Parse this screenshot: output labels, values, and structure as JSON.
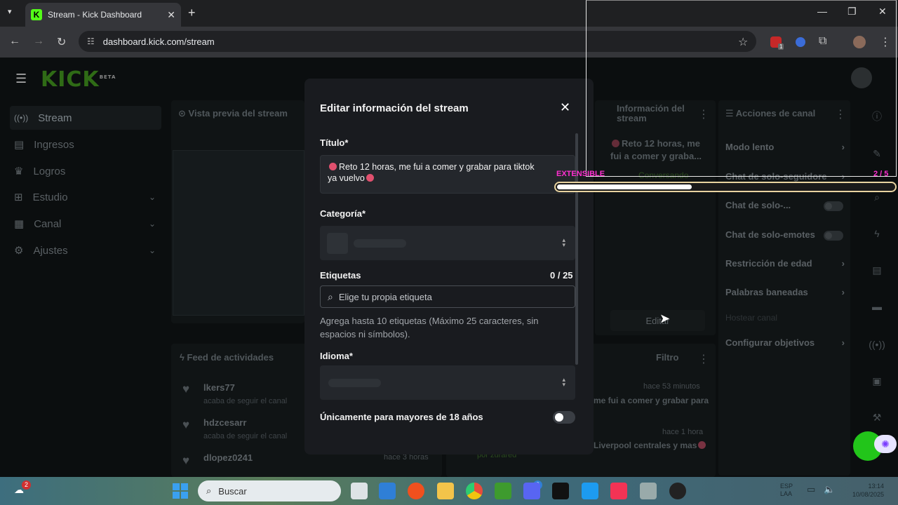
{
  "browser": {
    "tab_title": "Stream - Kick Dashboard",
    "favicon_letter": "K",
    "url": "dashboard.kick.com/stream",
    "ext_badge": "1"
  },
  "app": {
    "logo": "KICK",
    "logo_badge": "BETA"
  },
  "sidebar": {
    "items": [
      {
        "label": "Stream",
        "icon": "broadcast-icon",
        "active": true
      },
      {
        "label": "Ingresos",
        "icon": "wallet-icon"
      },
      {
        "label": "Logros",
        "icon": "trophy-icon"
      },
      {
        "label": "Estudio",
        "icon": "studio-icon",
        "expandable": true
      },
      {
        "label": "Canal",
        "icon": "channel-icon",
        "expandable": true
      },
      {
        "label": "Ajustes",
        "icon": "gear-icon",
        "expandable": true
      }
    ]
  },
  "preview": {
    "title": "Vista previa del stream"
  },
  "stream_info": {
    "title": "Información del stream",
    "snippet": "Reto 12 horas, me fui a comer y graba...",
    "edit_button": "Editar",
    "category_snippet": "Conversando"
  },
  "activity": {
    "title": "Feed de actividades",
    "filter": "Filtro",
    "items": [
      {
        "user": "lkers77",
        "action": "acaba de seguir el canal",
        "time": "hace 53 minutos"
      },
      {
        "user": "hdzcesarr",
        "action": "acaba de seguir el canal",
        "time": "hace 1 hora"
      },
      {
        "user": "dlopez0241",
        "action": "",
        "time": "hace 3 horas"
      }
    ],
    "message_1": "me fui a comer y grabar para",
    "message_2": "Liverpool centrales y mas",
    "by_user": "por zurared"
  },
  "channel_actions": {
    "title": "Acciones de canal",
    "items": [
      {
        "label": "Modo lento",
        "kind": "arrow"
      },
      {
        "label": "Chat de solo-seguidore",
        "kind": "arrow"
      },
      {
        "label": "Chat de solo-...",
        "kind": "toggle"
      },
      {
        "label": "Chat de solo-emotes",
        "kind": "toggle"
      },
      {
        "label": "Restricción de edad",
        "kind": "arrow"
      },
      {
        "label": "Palabras baneadas",
        "kind": "arrow"
      },
      {
        "label": "Hostear canal",
        "kind": "disabled"
      },
      {
        "label": "Configurar objetivos",
        "kind": "arrow"
      }
    ]
  },
  "modal": {
    "title": "Editar información del stream",
    "title_label": "Título*",
    "title_value_a": "Reto 12 horas, me fui a comer y grabar para tiktok",
    "title_value_b": "ya vuelvo",
    "category_label": "Categoría*",
    "tags_label": "Etiquetas",
    "tags_count": "0 / 25",
    "tags_placeholder": "Elige tu propia etiqueta",
    "tags_help": "Agrega hasta 10 etiquetas (Máximo 25 caracteres, sin espacios ni símbolos).",
    "language_label": "Idioma*",
    "adults_label": "Únicamente para mayores de 18 años",
    "adults_enabled": false
  },
  "extension_overlay": {
    "label": "EXTENSIBLE",
    "count": "2 / 5",
    "progress": 0.4
  },
  "taskbar": {
    "search_placeholder": "Buscar",
    "notif_badge": "2",
    "app_badge": "3",
    "lang_line1": "ESP",
    "lang_line2": "LAA",
    "time": "13:14",
    "date": "10/08/2025"
  },
  "colors": {
    "kick_green": "#53fc18",
    "modal_bg": "#191b1f",
    "ext_accent": "#ff2fd0"
  }
}
